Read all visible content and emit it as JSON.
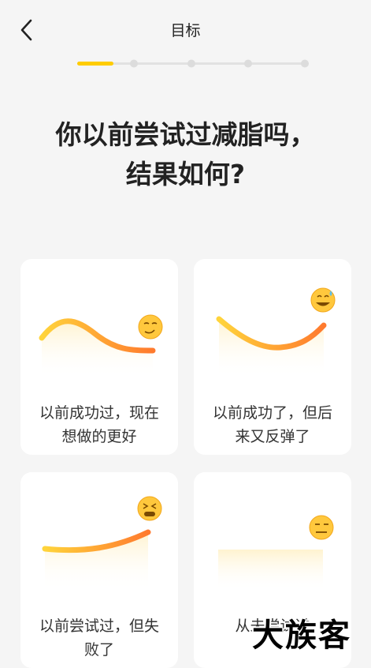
{
  "header": {
    "title": "目标",
    "back_icon": "chevron-left-icon"
  },
  "progress": {
    "total_steps": 5,
    "current_step": 1,
    "active_color": "#FFCC00",
    "inactive_color": "#E0E0E0"
  },
  "question": {
    "line1": "你以前尝试过减脂吗，",
    "line2": "结果如何?"
  },
  "options": [
    {
      "label_line1": "以前成功过，现在",
      "label_line2": "想做的更好",
      "emoji": "smirking-face-icon"
    },
    {
      "label_line1": "以前成功了，但后",
      "label_line2": "来又反弹了",
      "emoji": "grinning-sweat-face-icon"
    },
    {
      "label_line1": "以前尝试过，但失",
      "label_line2": "败了",
      "emoji": "tired-face-icon"
    },
    {
      "label_line1": "从未尝试过",
      "label_line2": "",
      "emoji": "expressionless-face-icon"
    }
  ],
  "watermark": {
    "text": "大族客"
  },
  "colors": {
    "gradient_start": "#FFD43B",
    "gradient_end": "#FF7A2E",
    "background": "#F5F5F5",
    "card": "#FFFFFF"
  }
}
